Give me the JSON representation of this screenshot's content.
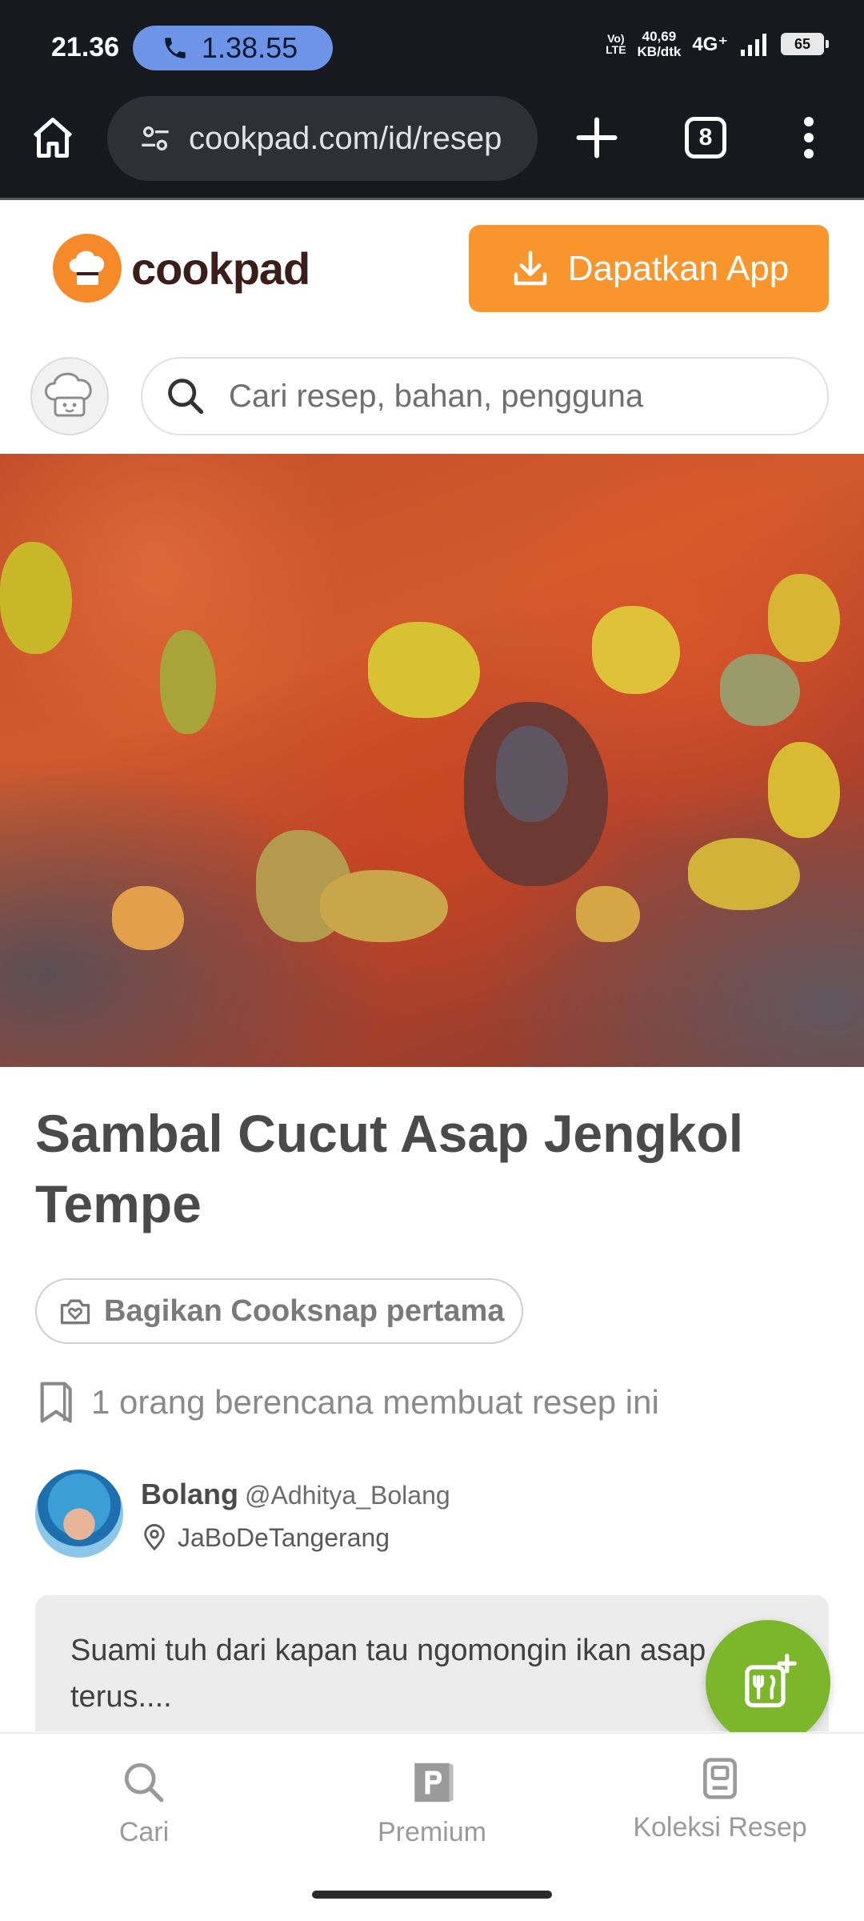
{
  "status_bar": {
    "time": "21.36",
    "call_duration": "1.38.55",
    "volte": "Vo)\nLTE",
    "net_speed": "40,69\nKB/dtk",
    "net_type": "4G⁺",
    "battery": "65"
  },
  "browser": {
    "url": "cookpad.com/id/resep",
    "tab_count": "8"
  },
  "header": {
    "logo_text": "cookpad",
    "get_app_label": "Dapatkan App"
  },
  "search": {
    "placeholder": "Cari resep, bahan, pengguna"
  },
  "recipe": {
    "title": "Sambal Cucut Asap Jengkol Tempe",
    "cooksnap_label": "Bagikan Cooksnap pertama",
    "plan_text": "1 orang berencana membuat resep ini",
    "author_name": "Bolang",
    "author_handle": "@Adhitya_Bolang",
    "author_location": "JaBoDeTangerang",
    "story": "Suami tuh dari kapan tau ngomongin ikan asap terus...."
  },
  "bottom_nav": {
    "items": [
      {
        "label": "Cari",
        "icon": "search-icon"
      },
      {
        "label": "Premium",
        "icon": "premium-icon"
      },
      {
        "label": "Koleksi Resep",
        "icon": "collection-icon"
      }
    ]
  },
  "colors": {
    "brand_orange": "#f8952d",
    "fab_green": "#7cb72b",
    "browser_dark": "#17191e"
  }
}
